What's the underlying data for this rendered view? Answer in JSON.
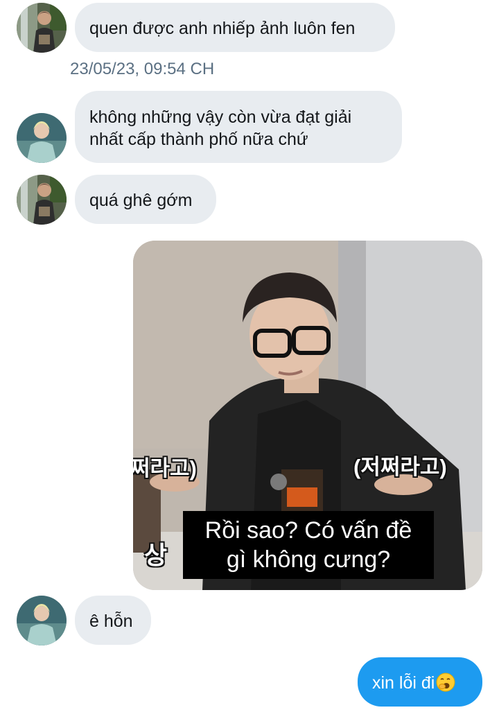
{
  "conversation": {
    "messages": [
      {
        "id": "m1",
        "direction": "incoming",
        "avatar": "avatar-waterfall",
        "text": "quen được anh nhiếp ảnh luôn fen"
      },
      {
        "id": "m2",
        "direction": "incoming",
        "avatar": "avatar-blonde",
        "lines": [
          "không những vậy còn vừa đạt giải",
          "nhất cấp thành phố nữa chứ"
        ]
      },
      {
        "id": "m3",
        "direction": "incoming",
        "avatar": "avatar-waterfall",
        "text": "quá ghê gớm"
      },
      {
        "id": "m4",
        "direction": "outgoing",
        "type": "image",
        "image": {
          "caption_left": "쩌라고)",
          "caption_right": "(저쩌라고)",
          "caption_bottom_left": "상",
          "subtitle_lines": [
            "Rồi sao? Có vấn đề",
            "gì không cưng?"
          ]
        }
      },
      {
        "id": "m5",
        "direction": "incoming",
        "avatar": "avatar-blonde",
        "text": "ê hỗn"
      },
      {
        "id": "m6",
        "direction": "outgoing",
        "text": "xin lỗi đi",
        "emoji": "yawning-face-icon"
      }
    ],
    "timestamp": "23/05/23, 09:54 CH"
  },
  "colors": {
    "incoming_bubble": "#e8ecf0",
    "outgoing_bubble": "#1d9bf0",
    "timestamp": "#5b7083",
    "text": "#14171a"
  }
}
